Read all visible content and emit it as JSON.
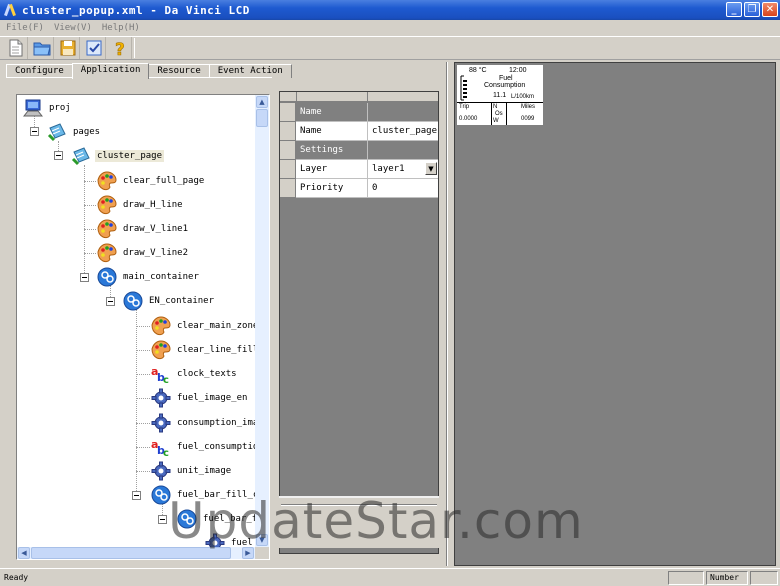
{
  "window": {
    "title": "cluster_popup.xml - Da Vinci LCD"
  },
  "menu": {
    "items": [
      "File(F)",
      "View(V)",
      "Help(H)"
    ]
  },
  "toolbar": {
    "buttons": [
      "new-icon",
      "open-icon",
      "save-icon",
      "check-icon",
      "help-icon"
    ]
  },
  "tabs": [
    "Configure",
    "Application",
    "Resource",
    "Event Action"
  ],
  "tree": {
    "proj": "proj",
    "pages": "pages",
    "cluster_page": "cluster_page",
    "clear_full_page": "clear_full_page",
    "draw_H_line": "draw_H_line",
    "draw_V_line1": "draw_V_line1",
    "draw_V_line2": "draw_V_line2",
    "main_container": "main_container",
    "EN_container": "EN_container",
    "clear_main_zone": "clear_main_zone_",
    "clear_line_fill": "clear_line_fill",
    "clock_texts": "clock_texts",
    "fuel_image_en": "fuel_image_en",
    "consumption_image": "consumption_image",
    "fuel_consumption": "fuel_consumption_",
    "unit_image": "unit_image",
    "fuel_bar_fill_con": "fuel_bar_fill_con",
    "fuel_bar": "fuel_bar_fi",
    "fuel": "fuel"
  },
  "properties": {
    "section1": "Name",
    "name_key": "Name",
    "name_value": "cluster_page",
    "section2": "Settings",
    "layer_key": "Layer",
    "layer_value": "layer1",
    "priority_key": "Priority",
    "priority_value": "0"
  },
  "lcd": {
    "temp": "88 °C",
    "time": "12:00",
    "fuel_line1": "Fuel",
    "fuel_line2": "Consumption",
    "fuel_value": "11.1",
    "fuel_unit": "L/100km",
    "trip_label": "Trip",
    "trip_value": "0.0000",
    "miles_label": "Miles",
    "miles_value": "0099",
    "mode_text": "N",
    "mode_text2": "Os",
    "mode_text3": "W"
  },
  "status": {
    "ready": "Ready",
    "number": "Number"
  },
  "watermark": "UpdateStar.com"
}
